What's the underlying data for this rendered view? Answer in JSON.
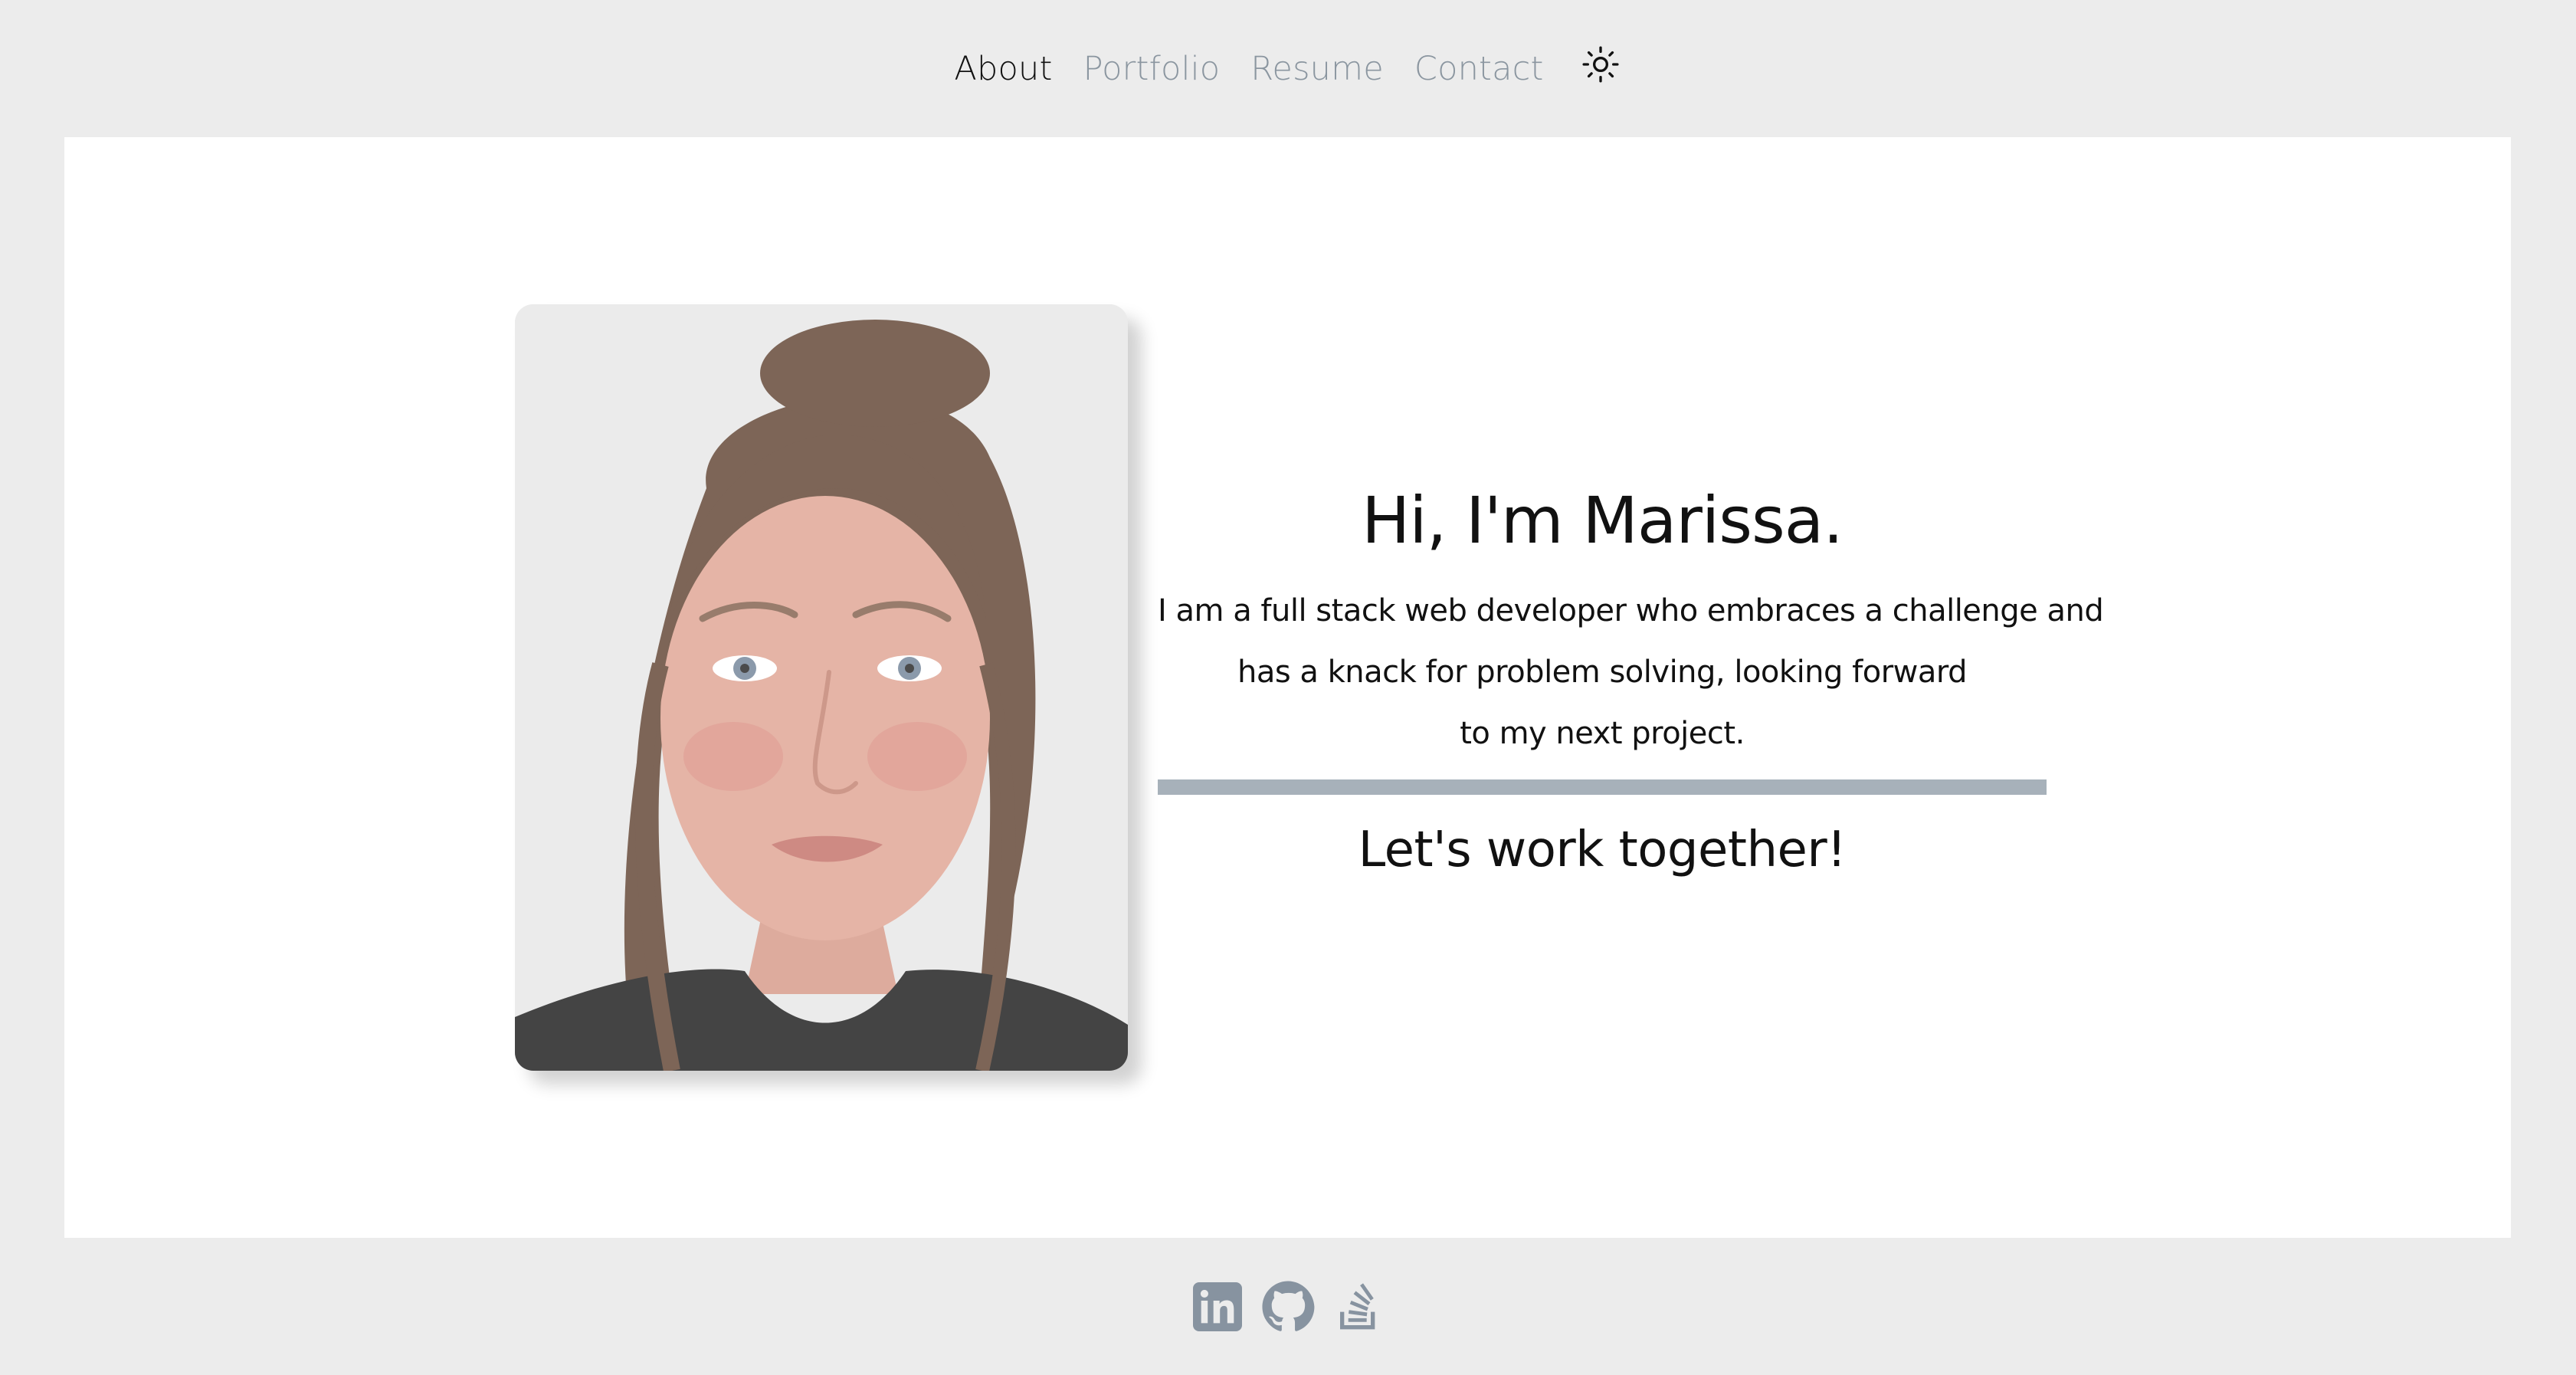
{
  "nav": {
    "items": [
      {
        "label": "About",
        "active": true
      },
      {
        "label": "Portfolio",
        "active": false
      },
      {
        "label": "Resume",
        "active": false
      },
      {
        "label": "Contact",
        "active": false
      }
    ],
    "theme_toggle_icon": "sun-icon"
  },
  "hero": {
    "portrait_icon": "profile-photo",
    "title": "Hi, I'm Marissa.",
    "lines": [
      "I am a full stack web developer who embraces a challenge and",
      "has a knack for problem solving, looking forward",
      "to my next project."
    ],
    "cta": "Let's work together!"
  },
  "footer": {
    "links": [
      {
        "icon": "linkedin-icon"
      },
      {
        "icon": "github-icon"
      },
      {
        "icon": "stackoverflow-icon"
      }
    ]
  },
  "colors": {
    "page_bg": "#ececec",
    "card_bg": "#ffffff",
    "nav_inactive": "#8b96a0",
    "nav_active": "#111111",
    "rule": "#a7b1ba",
    "icon_gray": "#8793a0"
  }
}
